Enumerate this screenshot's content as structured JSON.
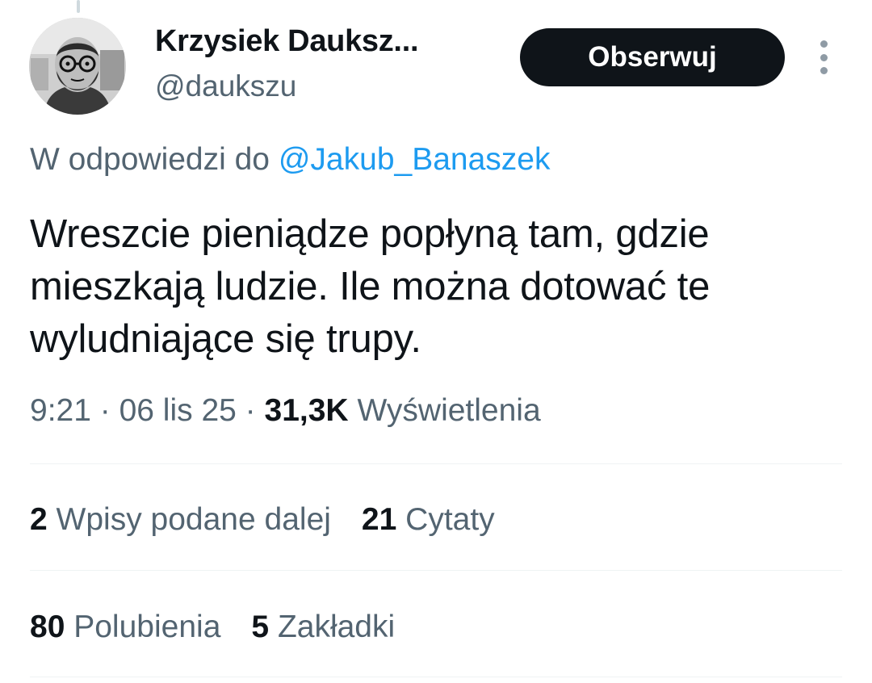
{
  "author": {
    "display_name": "Krzysiek Dauksz...",
    "handle": "@daukszu",
    "avatar_icon": "profile-photo"
  },
  "follow_button": {
    "label": "Obserwuj"
  },
  "more_icon": "more-vertical-icon",
  "reply_context": {
    "prefix": "W odpowiedzi do",
    "mention": "@Jakub_Banaszek"
  },
  "tweet": {
    "text": "Wreszcie pieniądze popłyną tam, gdzie\nmieszkają ludzie. Ile można dotować te\nwyludniające się trupy."
  },
  "meta": {
    "time": "9:21",
    "sep1": " · ",
    "date": "06 lis 25",
    "sep2": " · ",
    "views_count": "31,3K",
    "views_label": "Wyświetlenia"
  },
  "stats": {
    "reposts_count": "2",
    "reposts_label": "Wpisy podane dalej",
    "quotes_count": "21",
    "quotes_label": "Cytaty",
    "likes_count": "80",
    "likes_label": "Polubienia",
    "bookmarks_count": "5",
    "bookmarks_label": "Zakładki"
  },
  "colors": {
    "text_primary": "#0f1419",
    "text_secondary": "#536471",
    "link": "#1d9bf0",
    "button_bg": "#0f1419",
    "divider": "#eff3f4"
  }
}
